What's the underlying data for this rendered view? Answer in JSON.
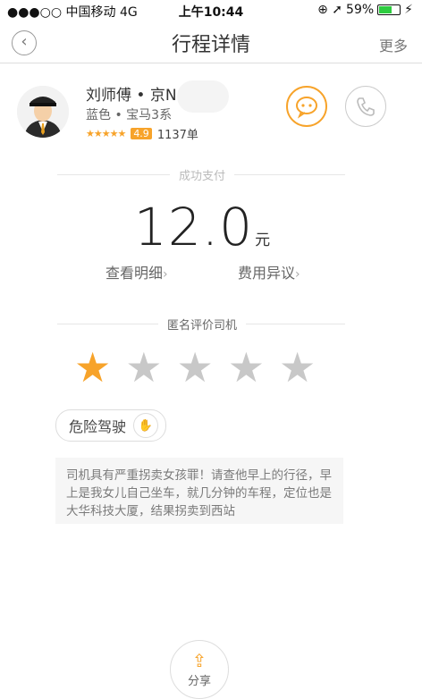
{
  "status": {
    "carrier": "●●●○○ 中国移动  4G",
    "time": "上午10:44",
    "battery": "59%",
    "icons": "⊕ ➚"
  },
  "nav": {
    "title": "行程详情",
    "more": "更多",
    "back_icon": "chevron-left-icon"
  },
  "driver": {
    "name": "刘师傅 • 京N",
    "car": "蓝色 • 宝马3系",
    "stars": "★★★★★",
    "score": "4.9",
    "orders": "1137单"
  },
  "payment": {
    "status_label": "成功支付",
    "amount": "12.0",
    "unit": "元",
    "detail_link": "查看明细",
    "dispute_link": "费用异议",
    "chev": "›"
  },
  "evaluation": {
    "label": "匿名评价司机",
    "rating": 1,
    "max": 5,
    "tag": "危险驾驶"
  },
  "comment": "司机具有严重拐卖女孩罪！请查他早上的行径，早上是我女儿自己坐车，就几分钟的车程，定位也是大华科技大厦，结果拐卖到西站",
  "share": {
    "label": "分享"
  },
  "colors": {
    "accent": "#f7a32a",
    "inactive_star": "#c8c8c8"
  }
}
